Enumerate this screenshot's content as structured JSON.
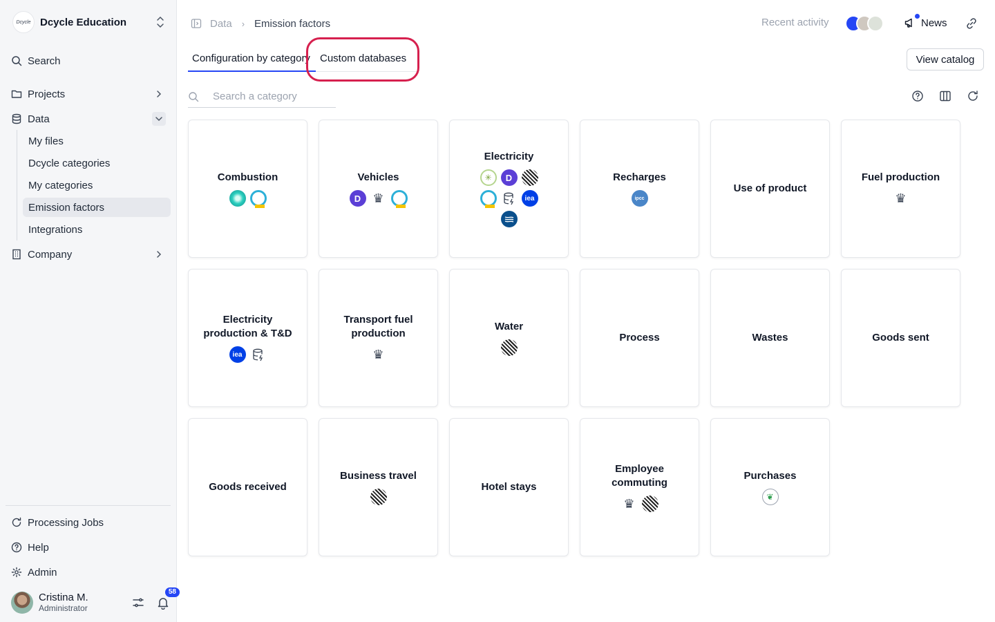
{
  "org": {
    "name": "Dcycle Education",
    "logo_text": "Dcycle"
  },
  "sidebar": {
    "search": "Search",
    "projects": "Projects",
    "data": "Data",
    "data_items": [
      "My files",
      "Dcycle categories",
      "My categories",
      "Emission factors",
      "Integrations"
    ],
    "company": "Company",
    "processing_jobs": "Processing Jobs",
    "help": "Help",
    "admin": "Admin"
  },
  "user": {
    "name": "Cristina M.",
    "role": "Administrator",
    "notifications": "58"
  },
  "breadcrumb": {
    "parent": "Data",
    "current": "Emission factors"
  },
  "topbar": {
    "recent_activity": "Recent activity",
    "news": "News"
  },
  "tabs": {
    "config": "Configuration by category",
    "custom": "Custom databases"
  },
  "view_catalog": "View catalog",
  "search": {
    "placeholder": "Search a category"
  },
  "colors": {
    "accent": "#2546f5",
    "highlight": "#d6204e"
  },
  "cards": [
    {
      "title": "Combustion",
      "icons": [
        "teal",
        "ring"
      ]
    },
    {
      "title": "Vehicles",
      "icons": [
        "purple",
        "crest",
        "ring"
      ]
    },
    {
      "title": "Electricity",
      "icons": [
        "green",
        "purple",
        "stripe",
        "ring",
        "db",
        "iea",
        "dark"
      ]
    },
    {
      "title": "Recharges",
      "icons": [
        "ipcc"
      ]
    },
    {
      "title": "Use of product",
      "icons": []
    },
    {
      "title": "Fuel production",
      "icons": [
        "crest"
      ]
    },
    {
      "title": "Electricity production & T&D",
      "icons": [
        "iea",
        "db"
      ]
    },
    {
      "title": "Transport fuel production",
      "icons": [
        "crest"
      ]
    },
    {
      "title": "Water",
      "icons": [
        "stripe"
      ]
    },
    {
      "title": "Process",
      "icons": []
    },
    {
      "title": "Wastes",
      "icons": []
    },
    {
      "title": "Goods sent",
      "icons": []
    },
    {
      "title": "Goods received",
      "icons": []
    },
    {
      "title": "Business travel",
      "icons": [
        "stripe"
      ]
    },
    {
      "title": "Hotel stays",
      "icons": []
    },
    {
      "title": "Employee commuting",
      "icons": [
        "crest",
        "stripe"
      ]
    },
    {
      "title": "Purchases",
      "icons": [
        "leaf"
      ]
    }
  ]
}
